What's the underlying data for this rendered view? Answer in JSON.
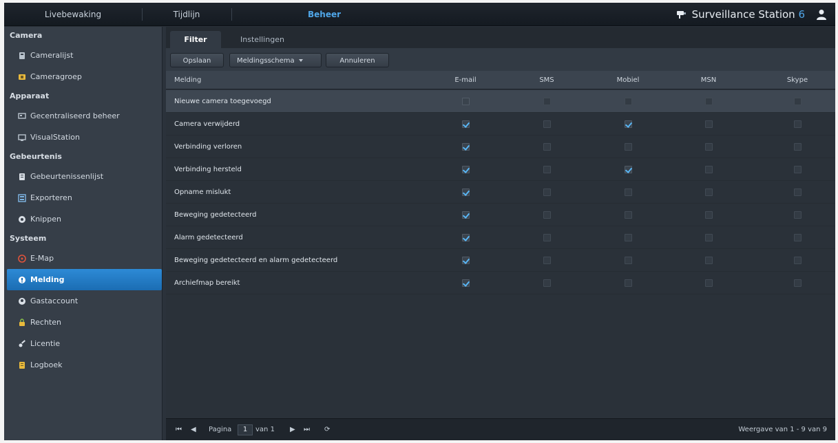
{
  "topbar": {
    "tabs": [
      "Livebewaking",
      "Tijdlijn",
      "Beheer"
    ],
    "brand": "Surveillance Station",
    "version": "6"
  },
  "sidebar": {
    "categories": [
      {
        "label": "Camera",
        "items": [
          {
            "label": "Cameralijst",
            "icon": "camera-icon"
          },
          {
            "label": "Cameragroep",
            "icon": "folder-icon"
          }
        ]
      },
      {
        "label": "Apparaat",
        "items": [
          {
            "label": "Gecentraliseerd beheer",
            "icon": "monitor-icon"
          },
          {
            "label": "VisualStation",
            "icon": "screen-icon"
          }
        ]
      },
      {
        "label": "Gebeurtenis",
        "items": [
          {
            "label": "Gebeurtenissenlijst",
            "icon": "list-icon"
          },
          {
            "label": "Exporteren",
            "icon": "export-icon"
          },
          {
            "label": "Knippen",
            "icon": "scissors-icon"
          }
        ]
      },
      {
        "label": "Systeem",
        "items": [
          {
            "label": "E-Map",
            "icon": "map-pin-icon"
          },
          {
            "label": "Melding",
            "icon": "bell-icon",
            "active": true
          },
          {
            "label": "Gastaccount",
            "icon": "user-icon"
          },
          {
            "label": "Rechten",
            "icon": "lock-icon"
          },
          {
            "label": "Licentie",
            "icon": "key-icon"
          },
          {
            "label": "Logboek",
            "icon": "log-icon"
          }
        ]
      }
    ]
  },
  "tabs": {
    "filter": "Filter",
    "instellingen": "Instellingen"
  },
  "toolbar": {
    "opslaan": "Opslaan",
    "meldingsschema": "Meldingsschema",
    "annuleren": "Annuleren"
  },
  "table": {
    "headers": [
      "Melding",
      "E-mail",
      "SMS",
      "Mobiel",
      "MSN",
      "Skype"
    ],
    "rows": [
      {
        "name": "Nieuwe camera toegevoegd",
        "values": [
          false,
          false,
          false,
          false,
          false
        ],
        "selected": true
      },
      {
        "name": "Camera verwijderd",
        "values": [
          true,
          false,
          true,
          false,
          false
        ]
      },
      {
        "name": "Verbinding verloren",
        "values": [
          true,
          false,
          false,
          false,
          false
        ]
      },
      {
        "name": "Verbinding hersteld",
        "values": [
          true,
          false,
          true,
          false,
          false
        ]
      },
      {
        "name": "Opname mislukt",
        "values": [
          true,
          false,
          false,
          false,
          false
        ]
      },
      {
        "name": "Beweging gedetecteerd",
        "values": [
          true,
          false,
          false,
          false,
          false
        ]
      },
      {
        "name": "Alarm gedetecteerd",
        "values": [
          true,
          false,
          false,
          false,
          false
        ]
      },
      {
        "name": "Beweging gedetecteerd en alarm gedetecteerd",
        "values": [
          true,
          false,
          false,
          false,
          false
        ]
      },
      {
        "name": "Archiefmap bereikt",
        "values": [
          true,
          false,
          false,
          false,
          false
        ]
      }
    ]
  },
  "pagination": {
    "page_label": "Pagina",
    "page_value": "1",
    "of_label": "van 1",
    "status": "Weergave van 1 - 9 van 9"
  },
  "colors": {
    "accent": "#4fa6e8",
    "active_item": "#2d8ad6",
    "background": "#2a3139"
  }
}
